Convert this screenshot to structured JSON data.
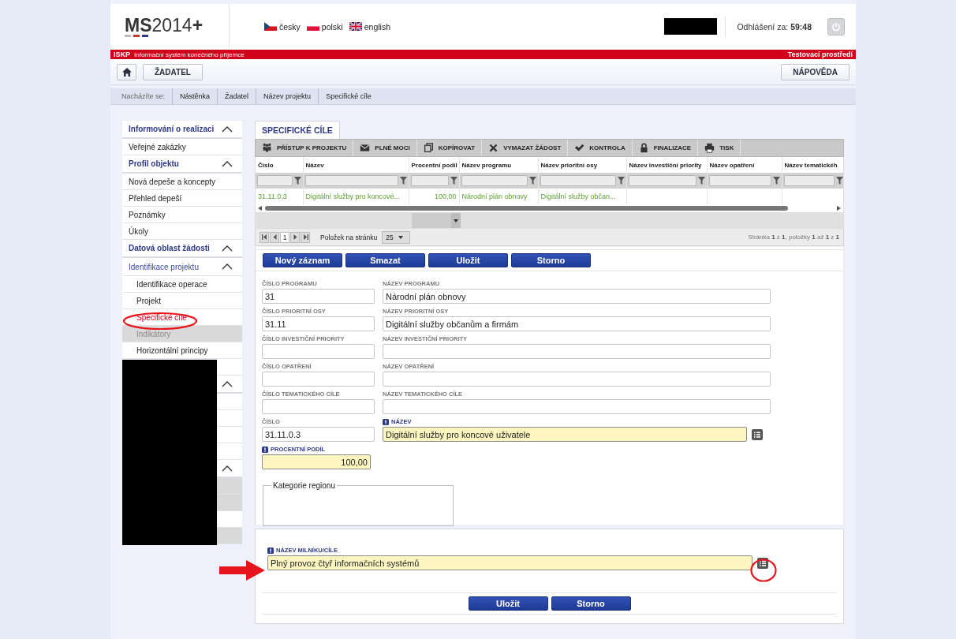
{
  "header": {
    "logo": "**MS**2014**+**",
    "languages": [
      {
        "kind": "cz",
        "label": "česky"
      },
      {
        "kind": "pl",
        "label": "polski"
      },
      {
        "kind": "gb",
        "label": "english"
      }
    ],
    "logout_label": "Odhlášení za:",
    "logout_time": "59:48"
  },
  "system_bar": {
    "code": "ISKP",
    "name": "Informační systém konečného příjemce",
    "environment": "Testovací prostředí"
  },
  "nav": {
    "buttons": [
      {
        "kind": "home"
      },
      {
        "kind": "text",
        "label": "ŽADATEL"
      }
    ],
    "help": "NÁPOVĚDA"
  },
  "breadcrumb": {
    "label": "Nacházíte se:",
    "items": [
      "Nástěnka",
      "Žadatel",
      "Název projektu",
      "Specifické cíle"
    ]
  },
  "sidebar": {
    "items": [
      {
        "kind": "section",
        "label": "Informování o realizaci",
        "expanded": true,
        "children": [
          {
            "kind": "item",
            "label": "Veřejné zakázky",
            "selected": false,
            "disabled": false
          }
        ]
      },
      {
        "kind": "section",
        "label": "Profil objektu",
        "expanded": true,
        "children": [
          {
            "kind": "item",
            "label": "Nová depeše a koncepty",
            "selected": false,
            "disabled": false
          },
          {
            "kind": "item",
            "label": "Přehled depeší",
            "selected": false,
            "disabled": false
          },
          {
            "kind": "item",
            "label": "Poznámky",
            "selected": false,
            "disabled": false
          },
          {
            "kind": "item",
            "label": "Úkoly",
            "selected": false,
            "disabled": false
          }
        ]
      },
      {
        "kind": "section",
        "label": "Datová oblast žádosti",
        "expanded": true,
        "children": [
          {
            "kind": "group",
            "label": "Identifikace projektu",
            "expanded": true,
            "children": [
              {
                "kind": "item",
                "label": "Identifikace operace",
                "selected": false,
                "disabled": false
              },
              {
                "kind": "item",
                "label": "Projekt",
                "selected": false,
                "disabled": false
              },
              {
                "kind": "item",
                "label": "Specifické cíle",
                "selected": true,
                "disabled": false
              },
              {
                "kind": "item",
                "label": "Indikátory",
                "selected": false,
                "disabled": true
              },
              {
                "kind": "item",
                "label": "Horizontální principy",
                "selected": false,
                "disabled": false
              }
            ]
          },
          {
            "kind": "redacted",
            "disabled": false
          }
        ]
      },
      {
        "kind": "redacted-section",
        "expanded": true,
        "children": [
          {
            "kind": "redacted",
            "disabled": false
          },
          {
            "kind": "redacted",
            "disabled": false
          },
          {
            "kind": "redacted",
            "disabled": false
          },
          {
            "kind": "redacted",
            "disabled": false
          }
        ]
      },
      {
        "kind": "redacted-section",
        "expanded": true,
        "children": [
          {
            "kind": "redacted",
            "disabled": true
          },
          {
            "kind": "redacted",
            "disabled": true
          },
          {
            "kind": "redacted",
            "disabled": false
          },
          {
            "kind": "redacted",
            "disabled": true
          }
        ]
      }
    ]
  },
  "main": {
    "tab": {
      "label": "SPECIFICKÉ CÍLE",
      "selected": true
    },
    "toolbar": [
      {
        "kind": "people",
        "label": "PŘÍSTUP K PROJEKTU"
      },
      {
        "kind": "mail",
        "label": "PLNÉ MOCI"
      },
      {
        "kind": "copy",
        "label": "KOPÍROVAT"
      },
      {
        "kind": "delete",
        "label": "VYMAZAT ŽÁDOST"
      },
      {
        "kind": "check",
        "label": "KONTROLA"
      },
      {
        "kind": "lock",
        "label": "FINALIZACE"
      },
      {
        "kind": "print",
        "label": "TISK"
      }
    ],
    "grid": {
      "columns": [
        "Číslo",
        "Název",
        "Procentní podíl",
        "Název programu",
        "Název prioritní osy",
        "Název investiční priority",
        "Název opatření",
        "Název tematickéh"
      ],
      "rows": [
        {
          "cells": [
            "31.11.0.3",
            "Digitální služby pro koncové...",
            "100,00",
            "Národní plán obnovy",
            "Digitální služby občan...",
            null,
            null,
            null
          ]
        }
      ]
    },
    "pager": {
      "page": "1",
      "page_size_label": "Položek na stránku",
      "page_size": "25",
      "summary": "Stránka **1** z **1**, položky **1** až **1** z **1**"
    }
  },
  "form": {
    "buttons": [
      "Nový záznam",
      "Smazat",
      "Uložit",
      "Storno"
    ],
    "fields": [
      {
        "kind": "short",
        "label": "ČÍSLO PROGRAMU",
        "value": "31",
        "required": false
      },
      {
        "kind": "wide",
        "label": "NÁZEV PROGRAMU",
        "value": "Národní plán obnovy",
        "required": false
      },
      {
        "kind": "short",
        "label": "ČÍSLO PRIORITNÍ OSY",
        "value": "31.11",
        "required": false
      },
      {
        "kind": "wide",
        "label": "NÁZEV PRIORITNÍ OSY",
        "value": "Digitální služby občanům a firmám",
        "required": false
      },
      {
        "kind": "short",
        "label": "ČÍSLO INVESTIČNÍ PRIORITY",
        "required": false
      },
      {
        "kind": "wide",
        "label": "NÁZEV INVESTIČNÍ PRIORITY",
        "required": false
      },
      {
        "kind": "short",
        "label": "ČÍSLO OPATŘENÍ",
        "required": false
      },
      {
        "kind": "wide",
        "label": "NÁZEV OPATŘENÍ",
        "required": false
      },
      {
        "kind": "short",
        "label": "ČÍSLO TEMATICKÉHO CÍLE",
        "required": false
      },
      {
        "kind": "wide",
        "label": "NÁZEV TEMATICKÉHO CÍLE",
        "required": false
      },
      {
        "kind": "short",
        "label": "ČÍSLO",
        "value": "31.11.0.3",
        "required": false
      },
      {
        "kind": "wide-list",
        "label": "NÁZEV",
        "value": "Digitální služby pro koncové uživatele",
        "required": true
      },
      {
        "kind": "number",
        "label": "PROCENTNÍ PODÍL",
        "value": "100,00",
        "required": true
      }
    ],
    "fieldset": "Kategorie regionu"
  },
  "milestone": {
    "field": {
      "label": "NÁZEV MILNÍKU/CÍLE",
      "value": "Plný provoz čtyř informačních systémů",
      "required": true
    },
    "buttons": [
      "Uložit",
      "Storno"
    ]
  }
}
